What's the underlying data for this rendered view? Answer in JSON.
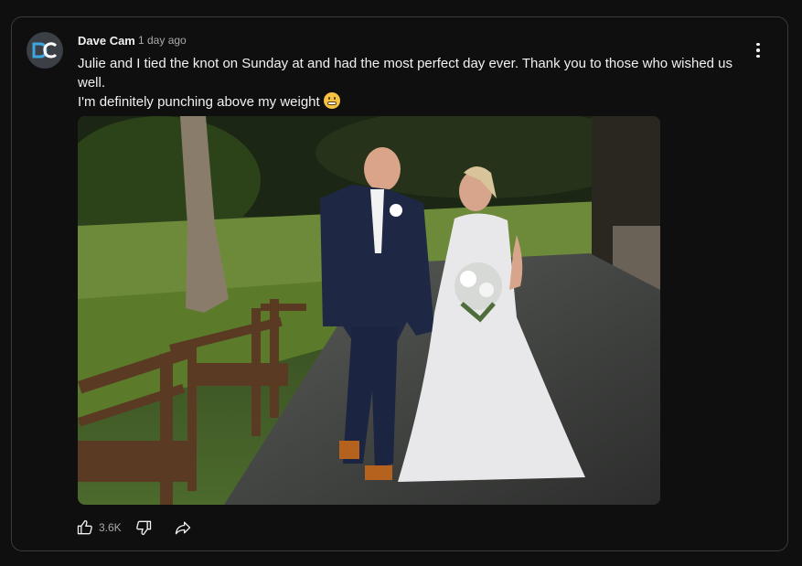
{
  "comment": {
    "author": "Dave Cam",
    "timestamp": "1 day ago",
    "text_line1": "Julie and I tied the knot on Sunday at and had the most perfect day ever. Thank you to those who wished us well.",
    "text_line2": "I'm definitely punching above my weight",
    "emoji": "grimacing-face-emoji",
    "avatar_initials": "DC",
    "like_count": "3.6K",
    "photo": "wedding-photo"
  },
  "icons": [
    "more-vert-icon",
    "thumb-up-icon",
    "thumb-down-icon",
    "share-icon"
  ],
  "colors": {
    "background": "#0f0f0f",
    "border": "#3a3a3a",
    "text": "#f1f1f1",
    "secondary_text": "#aaaaaa",
    "avatar_bg": "#3b3f46",
    "logo_blue": "#3ea6e0"
  }
}
